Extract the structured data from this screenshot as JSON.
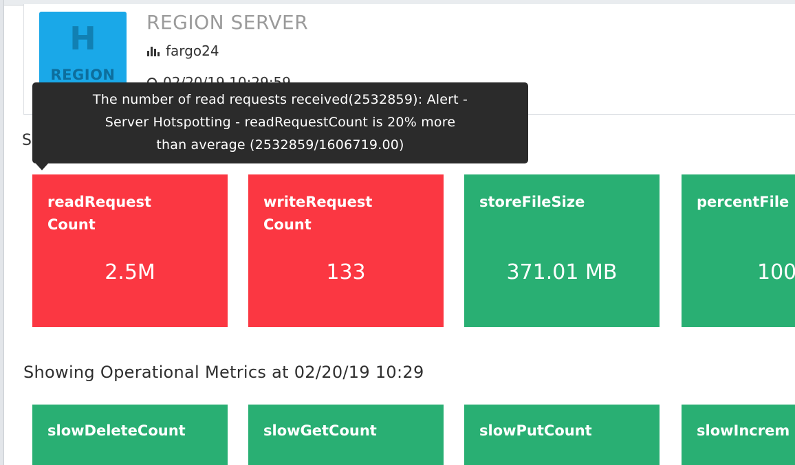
{
  "header": {
    "icon_letter": "H",
    "icon_label": "REGION",
    "title": "REGION SERVER",
    "host": "fargo24",
    "timestamp": "02/20/19 10:29:59"
  },
  "hidden_section_peek": "S",
  "tooltip": {
    "line1": "The number of read requests received(2532859): Alert -",
    "line2": "Server Hotspotting - readRequestCount is 20% more",
    "line3": "than average (2532859/1606719.00)"
  },
  "metrics": [
    {
      "label_line1": "readRequest",
      "label_line2": "Count",
      "value": "2.5M",
      "status": "alert"
    },
    {
      "label_line1": "writeRequest",
      "label_line2": "Count",
      "value": "133",
      "status": "alert"
    },
    {
      "label_line1": "storeFileSize",
      "label_line2": "",
      "value": "371.01 MB",
      "status": "ok"
    },
    {
      "label_line1": "percentFile",
      "label_line2": "",
      "value": "100",
      "status": "ok"
    }
  ],
  "operational": {
    "heading": "Showing Operational Metrics at 02/20/19 10:29",
    "tiles": [
      {
        "label": "slowDeleteCount"
      },
      {
        "label": "slowGetCount"
      },
      {
        "label": "slowPutCount"
      },
      {
        "label": "slowIncrem"
      }
    ]
  },
  "colors": {
    "alert": "#fb3742",
    "ok": "#29af73",
    "icon_bg": "#1aa8e8",
    "tooltip_bg": "#2b2b2b"
  }
}
